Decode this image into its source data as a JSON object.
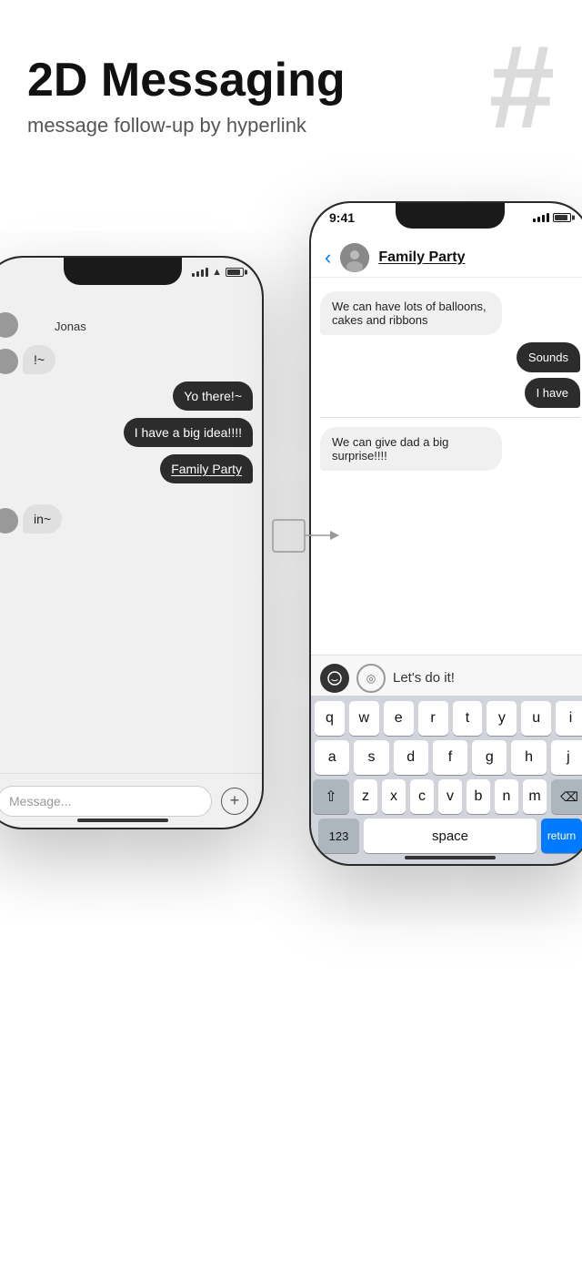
{
  "header": {
    "title": "2D Messaging",
    "subtitle": "message follow-up by hyperlink",
    "hash_symbol": "#"
  },
  "left_phone": {
    "status": {
      "signal": "signal",
      "wifi": "wifi",
      "battery": "battery"
    },
    "chat": {
      "sender": "Jonas",
      "messages": [
        {
          "type": "incoming",
          "text": "!~"
        },
        {
          "type": "outgoing",
          "text": "Yo there!~"
        },
        {
          "type": "outgoing",
          "text": "I have a big idea!!!!"
        },
        {
          "type": "outgoing_link",
          "text": "Family Party"
        },
        {
          "type": "incoming",
          "text": "in~"
        }
      ]
    },
    "input_placeholder": "Message...",
    "plus_label": "+"
  },
  "right_phone": {
    "status": {
      "time": "9:41",
      "signal": "signal",
      "battery": "battery"
    },
    "nav": {
      "back_label": "‹",
      "contact_name": "Family Party"
    },
    "chat": {
      "messages": [
        {
          "type": "incoming",
          "text": "We can have lots of balloons, cakes and ribbons"
        },
        {
          "type": "outgoing",
          "text": "Sounds"
        },
        {
          "type": "outgoing",
          "text": "I have"
        },
        {
          "type": "incoming",
          "text": "We can give dad a big surprise!!!!"
        }
      ]
    },
    "input": {
      "text": "Let's do it!"
    },
    "keyboard": {
      "row1": [
        "q",
        "w",
        "e",
        "r",
        "t",
        "y",
        "u",
        "i"
      ],
      "row2": [
        "a",
        "s",
        "d",
        "f",
        "g",
        "h",
        "j"
      ],
      "row3_shift": "⇧",
      "row3": [
        "z",
        "x",
        "c",
        "v",
        "b",
        "n",
        "m"
      ],
      "row3_delete": "⌫",
      "bottom_123": "123",
      "bottom_space": "space",
      "bottom_return": "return"
    }
  },
  "arrow": {
    "label": "arrow-connector"
  }
}
